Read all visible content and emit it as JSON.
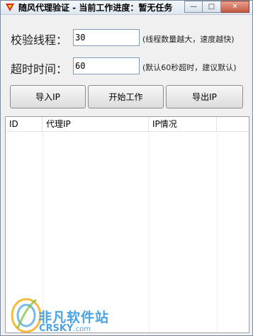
{
  "window": {
    "title": "随风代理验证 - 当前工作进度：暂无任务",
    "controls": {
      "minimize": "—",
      "maximize": "□",
      "close": "✕"
    }
  },
  "form": {
    "threads": {
      "label": "校验线程：",
      "value": "30",
      "hint": "(线程数量越大，速度越快)"
    },
    "timeout": {
      "label": "超时时间：",
      "value": "60",
      "hint": "(默认60秒超时，建议默认)"
    }
  },
  "buttons": {
    "import": "导入IP",
    "start": "开始工作",
    "export": "导出IP"
  },
  "table": {
    "columns": [
      "ID",
      "代理IP",
      "IP情况"
    ],
    "rows": []
  },
  "watermark": {
    "cn": "非凡软件站",
    "en": "CRSKY",
    "suffix": ".com"
  },
  "colors": {
    "title_gradient_top": "#f4f7fb",
    "close_button": "#c55a44",
    "watermark": "#4aa3e6"
  }
}
